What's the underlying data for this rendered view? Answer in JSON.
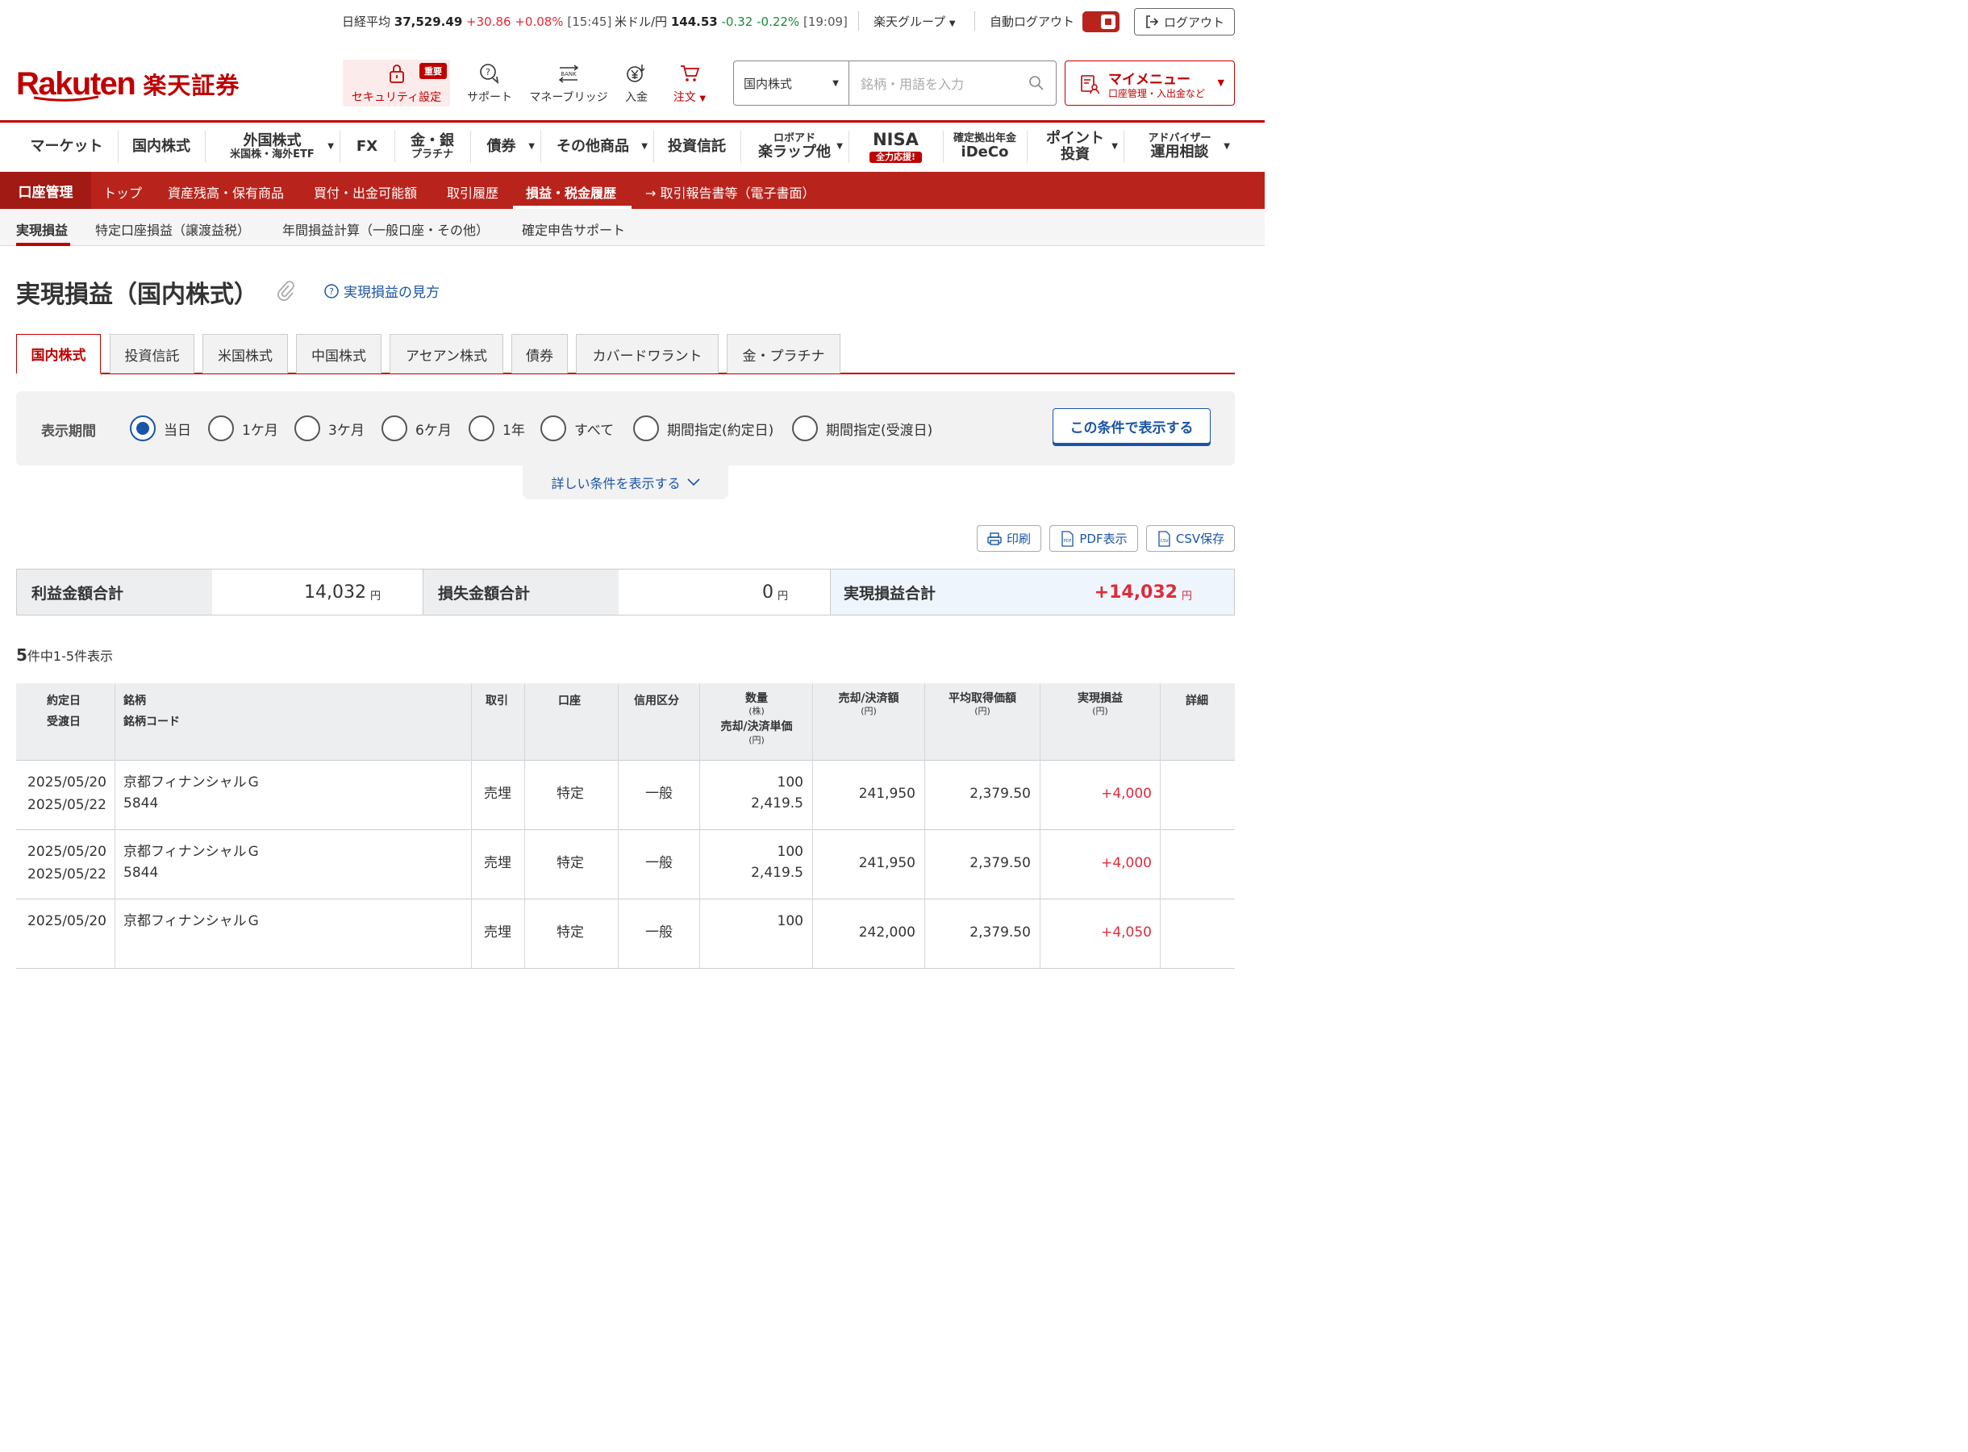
{
  "topbar": {
    "nikkei_label": "日経平均",
    "nikkei_value": "37,529.49",
    "nikkei_change": "+30.86",
    "nikkei_pct": "+0.08%",
    "nikkei_time": "[15:45]",
    "usdjpy_label": "米ドル/円",
    "usdjpy_value": "144.53",
    "usdjpy_change": "-0.32",
    "usdjpy_pct": "-0.22%",
    "usdjpy_time": "[19:09]",
    "group_label": "楽天グループ",
    "autologout_label": "自動ログアウト",
    "logout_label": "ログアウト"
  },
  "header": {
    "logo_en": "Rakuten",
    "logo_jp": "楽天証券",
    "security_badge": "重要",
    "security_label": "セキュリティ設定",
    "support_label": "サポート",
    "bank_icon_text": "BANK",
    "moneybridge_label": "マネーブリッジ",
    "deposit_label": "入金",
    "order_label": "注文",
    "search_select": "国内株式",
    "search_placeholder": "銘柄・用語を入力",
    "mymenu_title": "マイメニュー",
    "mymenu_sub": "口座管理・入出金など"
  },
  "mainnav": {
    "market": "マーケット",
    "domestic": "国内株式",
    "foreign_t": "外国株式",
    "foreign_s": "米国株・海外ETF",
    "fx": "FX",
    "gold_t": "金・銀",
    "gold_s": "プラチナ",
    "bond": "債券",
    "other": "その他商品",
    "fund": "投資信託",
    "robo_t": "ロボアド",
    "robo_s": "楽ラップ他",
    "nisa_t": "NISA",
    "nisa_badge": "全力応援!",
    "ideco_t": "確定拠出年金",
    "ideco_s": "iDeCo",
    "point_t": "ポイント",
    "point_s": "投資",
    "adv_t": "アドバイザー",
    "adv_s": "運用相談"
  },
  "subnav": {
    "title": "口座管理",
    "items": [
      "トップ",
      "資産残高・保有商品",
      "買付・出金可能額",
      "取引履歴",
      "損益・税金履歴",
      "→ 取引報告書等（電子書面）"
    ]
  },
  "tnav": {
    "items": [
      "実現損益",
      "特定口座損益（譲渡益税）",
      "年間損益計算（一般口座・その他）",
      "確定申告サポート"
    ]
  },
  "page": {
    "title": "実現損益（国内株式）",
    "howto": "実現損益の見方"
  },
  "product_tabs": [
    "国内株式",
    "投資信託",
    "米国株式",
    "中国株式",
    "アセアン株式",
    "債券",
    "カバードワラント",
    "金・プラチナ"
  ],
  "filter": {
    "label": "表示期間",
    "options": [
      "当日",
      "1ケ月",
      "3ケ月",
      "6ケ月",
      "1年",
      "すべて",
      "期間指定(約定日)",
      "期間指定(受渡日)"
    ],
    "selected": "当日",
    "apply_label": "この条件で表示する",
    "more_label": "詳しい条件を表示する"
  },
  "tools": {
    "print": "印刷",
    "pdf": "PDF表示",
    "csv": "CSV保存",
    "pdf_icon_text": "PDF",
    "csv_icon_text": "CSV"
  },
  "summary": {
    "profit_label": "利益金額合計",
    "profit_value": "14,032",
    "loss_label": "損失金額合計",
    "loss_value": "0",
    "total_label": "実現損益合計",
    "total_value": "+14,032",
    "yen": "円"
  },
  "count": {
    "total": "5",
    "text": "件中1-5件表示"
  },
  "table": {
    "headers": {
      "date1": "約定日",
      "date2": "受渡日",
      "name1": "銘柄",
      "name2": "銘柄コード",
      "trade": "取引",
      "account": "口座",
      "credit": "信用区分",
      "qty1": "数量",
      "qty1_unit": "(株)",
      "qty2": "売却/決済単価",
      "qty2_unit": "(円)",
      "amount": "売却/決済額",
      "amount_unit": "(円)",
      "avg": "平均取得価額",
      "avg_unit": "(円)",
      "pl": "実現損益",
      "pl_unit": "(円)",
      "detail": "詳細"
    },
    "rows": [
      {
        "trade_date": "2025/05/20",
        "settle_date": "2025/05/22",
        "name": "京都フィナンシャルＧ",
        "code": "5844",
        "trade": "売埋",
        "account": "特定",
        "credit": "一般",
        "qty": "100",
        "price": "2,419.5",
        "amount": "241,950",
        "avg": "2,379.50",
        "pl": "+4,000"
      },
      {
        "trade_date": "2025/05/20",
        "settle_date": "2025/05/22",
        "name": "京都フィナンシャルＧ",
        "code": "5844",
        "trade": "売埋",
        "account": "特定",
        "credit": "一般",
        "qty": "100",
        "price": "2,419.5",
        "amount": "241,950",
        "avg": "2,379.50",
        "pl": "+4,000"
      },
      {
        "trade_date": "2025/05/20",
        "settle_date": "",
        "name": "京都フィナンシャルＧ",
        "code": "",
        "trade": "売埋",
        "account": "特定",
        "credit": "一般",
        "qty": "100",
        "price": "",
        "amount": "242,000",
        "avg": "2,379.50",
        "pl": "+4,050"
      }
    ]
  },
  "colors": {
    "brand_red": "#bf0000",
    "link_blue": "#1a55a6",
    "profit_red": "#e02a3a",
    "loss_green": "#1a8a3a"
  }
}
